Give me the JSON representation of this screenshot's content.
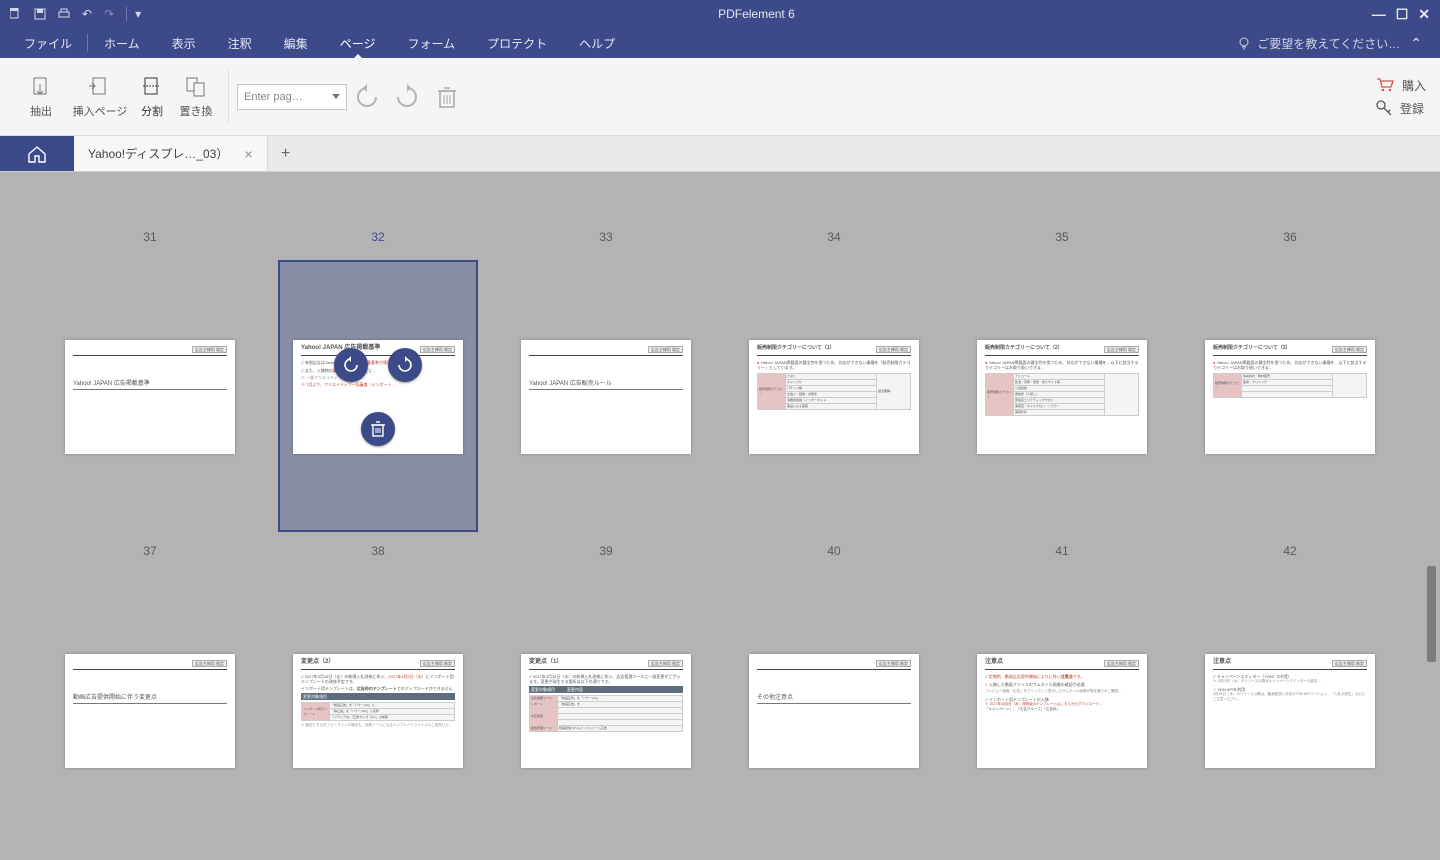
{
  "app": {
    "title": "PDFelement 6"
  },
  "menu": {
    "file": "ファイル",
    "home": "ホーム",
    "display": "表示",
    "annotate": "注釈",
    "edit": "編集",
    "page": "ページ",
    "form": "フォーム",
    "protect": "プロテクト",
    "help": "ヘルプ",
    "feedback": "ご要望を教えてください…"
  },
  "ribbon": {
    "extract": "抽出",
    "insert": "挿入ページ",
    "split": "分割",
    "replace": "置き換",
    "page_placeholder": "Enter pag…",
    "buy": "購入",
    "register": "登録"
  },
  "tab": {
    "doc_title": "Yahoo!ディスプレ…_03）"
  },
  "pages": {
    "labels": [
      "31",
      "32",
      "33",
      "34",
      "35",
      "36",
      "37",
      "38",
      "39",
      "40",
      "41",
      "42"
    ],
    "selected": 32
  },
  "thumbs": {
    "p31": {
      "title": "Yahoo! JAPAN 広告掲載基準"
    },
    "p32": {
      "title": "Yahoo! JAPAN 広告掲載基準"
    },
    "p33": {
      "title": "Yahoo! JAPAN 広告販売ルール"
    },
    "p34": {
      "title": "販売制限カテゴリーについて（1）"
    },
    "p35": {
      "title": "販売制限カテゴリーについて（2）"
    },
    "p36": {
      "title": "販売制限カテゴリーについて（3）"
    },
    "p37": {
      "title": "動画広告提供開始に伴う変更点"
    },
    "p38": {
      "title": "変更点（2）"
    },
    "p39": {
      "title": "変更点（1）"
    },
    "p40": {
      "title": "その他注意点"
    },
    "p41": {
      "title": "注意点"
    },
    "p42": {
      "title": "注意点"
    },
    "badge": "広告主様用\n限定"
  }
}
